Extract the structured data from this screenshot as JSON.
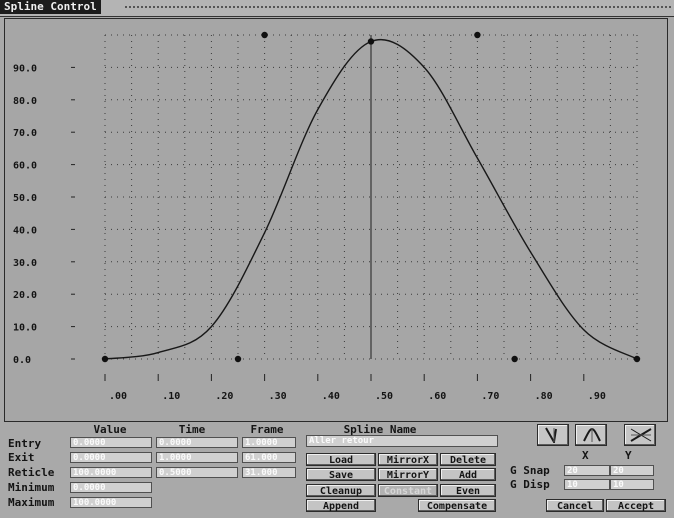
{
  "window": {
    "title": "Spline Control"
  },
  "chart_data": {
    "type": "line",
    "xlim": [
      0.0,
      1.0
    ],
    "ylim": [
      0.0,
      100.0
    ],
    "x_ticks": [
      ".00",
      ".10",
      ".20",
      ".30",
      ".40",
      ".50",
      ".60",
      ".70",
      ".80",
      ".90"
    ],
    "y_ticks": [
      "0.0",
      "10.0",
      "20.0",
      "30.0",
      "40.0",
      "50.0",
      "60.0",
      "70.0",
      "80.0",
      "90.0"
    ],
    "grid": true,
    "series": [
      {
        "x": [
          0.0,
          0.1,
          0.2,
          0.3,
          0.4,
          0.5,
          0.6,
          0.7,
          0.8,
          0.9,
          1.0
        ],
        "y": [
          0.0,
          2.0,
          10.0,
          39.0,
          77.0,
          98.0,
          90.0,
          62.0,
          33.0,
          9.0,
          0.0
        ]
      }
    ],
    "points": [
      {
        "x": 0.0,
        "y": 0.0
      },
      {
        "x": 0.25,
        "y": 0.0
      },
      {
        "x": 0.3,
        "y": 100.0
      },
      {
        "x": 0.5,
        "y": 98.0
      },
      {
        "x": 0.7,
        "y": 100.0
      },
      {
        "x": 0.77,
        "y": 0.0
      },
      {
        "x": 1.0,
        "y": 0.0
      }
    ],
    "cursor_x": 0.5
  },
  "panel": {
    "headers": {
      "value": "Value",
      "time": "Time",
      "frame": "Frame",
      "spline_name": "Spline Name",
      "x": "X",
      "y": "Y"
    },
    "rows": {
      "entry": {
        "label": "Entry",
        "value": "0.0000",
        "time": "0.0000",
        "frame": "1.0000"
      },
      "exit": {
        "label": "Exit",
        "value": "0.0000",
        "time": "1.0000",
        "frame": "61.000"
      },
      "reticle": {
        "label": "Reticle",
        "value": "100.0000",
        "time": "0.5000",
        "frame": "31.000"
      },
      "minimum": {
        "label": "Minimum",
        "value": "0.0000"
      },
      "maximum": {
        "label": "Maximum",
        "value": "100.0000"
      }
    },
    "spline_name": "Aller retour",
    "buttons": {
      "load": "Load",
      "mirror_x": "MirrorX",
      "delete": "Delete",
      "save": "Save",
      "mirror_y": "MirrorY",
      "add": "Add",
      "cleanup": "Cleanup",
      "constant": "Constant",
      "even": "Even",
      "append": "Append",
      "compensate": "Compensate",
      "cancel": "Cancel",
      "accept": "Accept"
    },
    "grid": {
      "snap_label": "G Snap",
      "snap_x": "20",
      "snap_y": "20",
      "disp_label": "G Disp",
      "disp_x": "10",
      "disp_y": "10"
    },
    "icons": [
      "linear-tangent-icon",
      "smooth-tangent-icon",
      "reset-axes-icon"
    ]
  }
}
